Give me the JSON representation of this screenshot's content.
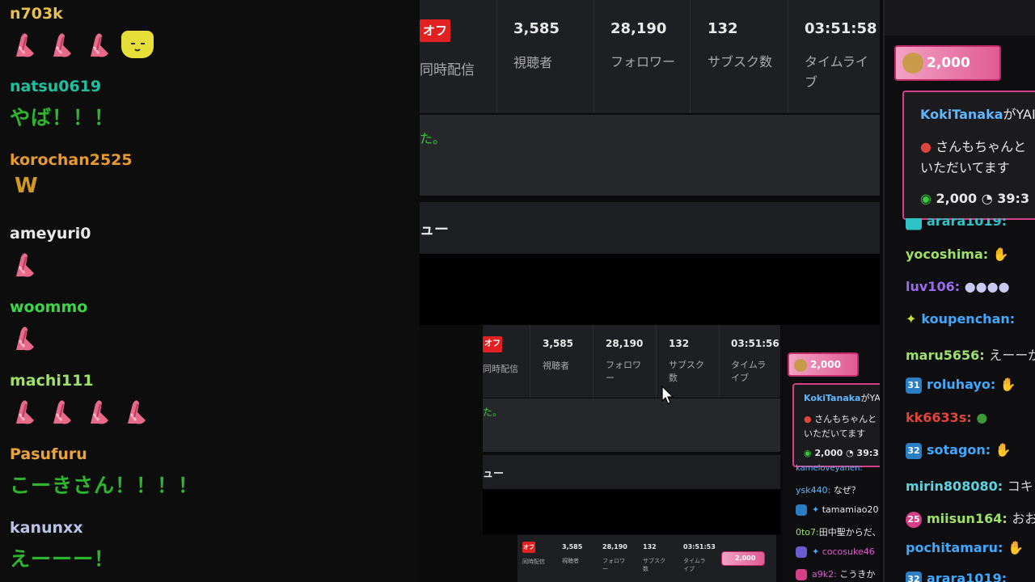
{
  "left_chat": {
    "messages": [
      {
        "user": "n703k",
        "color": "#e8c04e",
        "emotes": [
          "praying-hands",
          "praying-hands",
          "praying-hands",
          "cat"
        ]
      },
      {
        "user": "natsu0619",
        "color": "#1ec0a0",
        "text": "やば！！！"
      },
      {
        "user": "korochan2525",
        "color": "#e89b2c",
        "emotes": [
          "w"
        ]
      },
      {
        "user": "ameyuri0",
        "color": "#e8e8e8",
        "emotes": [
          "praying-hands"
        ]
      },
      {
        "user": "woommo",
        "color": "#3dd44a",
        "emotes": [
          "praying-hands"
        ]
      },
      {
        "user": "machi111",
        "color": "#9fe06a",
        "emotes": [
          "praying-hands",
          "praying-hands",
          "praying-hands",
          "praying-hands"
        ]
      },
      {
        "user": "Pasufuru",
        "color": "#e9a33a",
        "text": "こーきさん！！！！"
      },
      {
        "user": "kanunxx",
        "color": "#b9c3e8",
        "text": "えーーー！"
      }
    ],
    "w_glyph": "W"
  },
  "stats_large": {
    "off_label": "オフ",
    "simulcast_label": "同時配信",
    "viewers_value": "3,585",
    "viewers_label": "視聴者",
    "followers_value": "28,190",
    "followers_label": "フォロワー",
    "subs_value": "132",
    "subs_label": "サブスク数",
    "time_value": "03:51:58",
    "time_label": "タイムライブ",
    "notice_fragment": "た。",
    "menu_fragment": "ュー"
  },
  "stats_medium": {
    "off_label": "オフ",
    "simulcast_label": "同時配信",
    "viewers_value": "3,585",
    "viewers_label": "視聴者",
    "followers_value": "28,190",
    "followers_label": "フォロワー",
    "subs_value": "132",
    "subs_label": "サブスク数",
    "time_value": "03:51:56",
    "time_label": "タイムライブ",
    "notice_fragment": "た。",
    "menu_fragment": "ュー",
    "pill_amount": "2,000",
    "gift_user": "KokiTanaka",
    "gift_suffix": "がYA",
    "gift_line1": "さんもちゃんと",
    "gift_line2": "いただいてます",
    "gift_amount": "2,000",
    "gift_time": "39:3",
    "chat": [
      {
        "user": "kameloveyanen:",
        "text": ""
      },
      {
        "user": "ysk440:",
        "text": "なぜ？"
      },
      {
        "user": "tamamiao20",
        "text": ""
      },
      {
        "user": "0to7:",
        "text": "田中聖からだ、"
      },
      {
        "user": "cocosuke46",
        "text": ""
      },
      {
        "user": "a9k2:",
        "text": "こうきか"
      }
    ]
  },
  "stats_small": {
    "off_label": "オフ",
    "simulcast_label": "同時配信",
    "viewers_value": "3,585",
    "viewers_label": "視聴者",
    "followers_value": "28,190",
    "followers_label": "フォロワー",
    "subs_value": "132",
    "subs_label": "サブスク数",
    "time_value": "03:51:53",
    "time_label": "タイムライブ",
    "pill_amount": "2,000"
  },
  "right_chat": {
    "pill_amount": "2,000",
    "gift_user": "KokiTanaka",
    "gift_suffix": "がYAI",
    "gift_line1": "さんもちゃんと",
    "gift_line2": "いただいてます",
    "gift_amount": "2,000",
    "gift_time": "39:3",
    "messages": [
      {
        "user": "arara1019:",
        "color": "#2fc2c6",
        "badge": "",
        "text": ""
      },
      {
        "user": "yocoshima:",
        "color": "#9fe06a",
        "badge": "",
        "text": ""
      },
      {
        "user": "luv106:",
        "color": "#9a6cf0",
        "badge": "",
        "text": ""
      },
      {
        "user": "koupenchan:",
        "color": "#3fa8ff",
        "badge": "",
        "text": ""
      },
      {
        "user": "maru5656:",
        "color": "#9fe06a",
        "badge": "",
        "text": "えーーが"
      },
      {
        "user": "roluhayo:",
        "color": "#3fa8ff",
        "badge": "31",
        "text": ""
      },
      {
        "user": "kk6633s:",
        "color": "#e0453b",
        "badge": "",
        "text": ""
      },
      {
        "user": "sotagon:",
        "color": "#3fa8ff",
        "badge": "32",
        "text": ""
      },
      {
        "user": "mirin808080:",
        "color": "#5fd3e0",
        "badge": "",
        "text": "コキ"
      },
      {
        "user": "miisun164:",
        "color": "#9fe06a",
        "badge": "25",
        "text": "おお"
      },
      {
        "user": "pochitamaru:",
        "color": "#3fa8ff",
        "badge": "",
        "text": ""
      },
      {
        "user": "arara1019:",
        "color": "#2fc2c6",
        "badge": "32",
        "text": ""
      }
    ]
  },
  "colors": {
    "accent_pink": "#e05b93",
    "off_red": "#e12121",
    "chat_green": "#2db52d"
  }
}
